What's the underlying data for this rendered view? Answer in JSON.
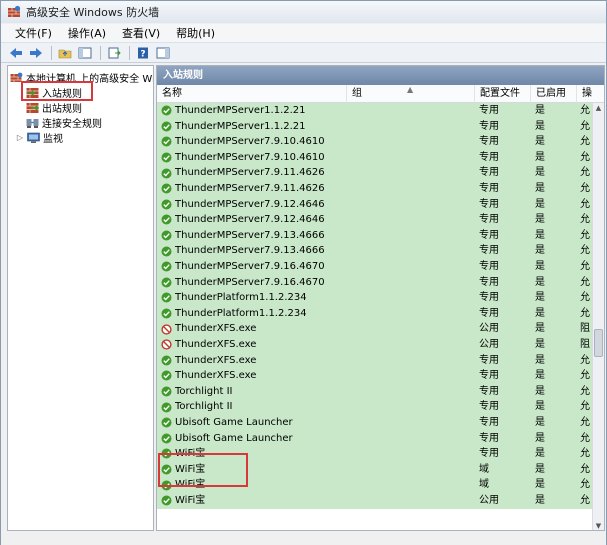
{
  "window": {
    "title": "高级安全 Windows 防火墙"
  },
  "menu": [
    "文件(F)",
    "操作(A)",
    "查看(V)",
    "帮助(H)"
  ],
  "tree": {
    "root": "本地计算机 上的高级安全 Windows",
    "items": [
      {
        "label": "入站规则",
        "icon": "inbound-rules-icon",
        "selected": true
      },
      {
        "label": "出站规则",
        "icon": "outbound-rules-icon"
      },
      {
        "label": "连接安全规则",
        "icon": "connection-security-icon"
      },
      {
        "label": "监视",
        "icon": "monitor-icon"
      }
    ]
  },
  "pane": {
    "header": "入站规则",
    "columns": [
      "名称",
      "组",
      "配置文件",
      "已启用",
      "操"
    ]
  },
  "rules": [
    {
      "name": "ThunderMPServer1.1.2.21",
      "group": "",
      "profile": "专用",
      "enabled": "是",
      "action": "允",
      "status": "allow"
    },
    {
      "name": "ThunderMPServer1.1.2.21",
      "group": "",
      "profile": "专用",
      "enabled": "是",
      "action": "允",
      "status": "allow"
    },
    {
      "name": "ThunderMPServer7.9.10.4610",
      "group": "",
      "profile": "专用",
      "enabled": "是",
      "action": "允",
      "status": "allow"
    },
    {
      "name": "ThunderMPServer7.9.10.4610",
      "group": "",
      "profile": "专用",
      "enabled": "是",
      "action": "允",
      "status": "allow"
    },
    {
      "name": "ThunderMPServer7.9.11.4626",
      "group": "",
      "profile": "专用",
      "enabled": "是",
      "action": "允",
      "status": "allow"
    },
    {
      "name": "ThunderMPServer7.9.11.4626",
      "group": "",
      "profile": "专用",
      "enabled": "是",
      "action": "允",
      "status": "allow"
    },
    {
      "name": "ThunderMPServer7.9.12.4646",
      "group": "",
      "profile": "专用",
      "enabled": "是",
      "action": "允",
      "status": "allow"
    },
    {
      "name": "ThunderMPServer7.9.12.4646",
      "group": "",
      "profile": "专用",
      "enabled": "是",
      "action": "允",
      "status": "allow"
    },
    {
      "name": "ThunderMPServer7.9.13.4666",
      "group": "",
      "profile": "专用",
      "enabled": "是",
      "action": "允",
      "status": "allow"
    },
    {
      "name": "ThunderMPServer7.9.13.4666",
      "group": "",
      "profile": "专用",
      "enabled": "是",
      "action": "允",
      "status": "allow"
    },
    {
      "name": "ThunderMPServer7.9.16.4670",
      "group": "",
      "profile": "专用",
      "enabled": "是",
      "action": "允",
      "status": "allow"
    },
    {
      "name": "ThunderMPServer7.9.16.4670",
      "group": "",
      "profile": "专用",
      "enabled": "是",
      "action": "允",
      "status": "allow"
    },
    {
      "name": "ThunderPlatform1.1.2.234",
      "group": "",
      "profile": "专用",
      "enabled": "是",
      "action": "允",
      "status": "allow"
    },
    {
      "name": "ThunderPlatform1.1.2.234",
      "group": "",
      "profile": "专用",
      "enabled": "是",
      "action": "允",
      "status": "allow"
    },
    {
      "name": "ThunderXFS.exe",
      "group": "",
      "profile": "公用",
      "enabled": "是",
      "action": "阻",
      "status": "block"
    },
    {
      "name": "ThunderXFS.exe",
      "group": "",
      "profile": "公用",
      "enabled": "是",
      "action": "阻",
      "status": "block"
    },
    {
      "name": "ThunderXFS.exe",
      "group": "",
      "profile": "专用",
      "enabled": "是",
      "action": "允",
      "status": "allow"
    },
    {
      "name": "ThunderXFS.exe",
      "group": "",
      "profile": "专用",
      "enabled": "是",
      "action": "允",
      "status": "allow"
    },
    {
      "name": "Torchlight II",
      "group": "",
      "profile": "专用",
      "enabled": "是",
      "action": "允",
      "status": "allow"
    },
    {
      "name": "Torchlight II",
      "group": "",
      "profile": "专用",
      "enabled": "是",
      "action": "允",
      "status": "allow"
    },
    {
      "name": "Ubisoft Game Launcher",
      "group": "",
      "profile": "专用",
      "enabled": "是",
      "action": "允",
      "status": "allow"
    },
    {
      "name": "Ubisoft Game Launcher",
      "group": "",
      "profile": "专用",
      "enabled": "是",
      "action": "允",
      "status": "allow"
    },
    {
      "name": "WiFi宝",
      "group": "",
      "profile": "专用",
      "enabled": "是",
      "action": "允",
      "status": "allow"
    },
    {
      "name": "WiFi宝",
      "group": "",
      "profile": "域",
      "enabled": "是",
      "action": "允",
      "status": "allow"
    },
    {
      "name": "WiFi宝",
      "group": "",
      "profile": "域",
      "enabled": "是",
      "action": "允",
      "status": "allow"
    },
    {
      "name": "WiFi宝",
      "group": "",
      "profile": "公用",
      "enabled": "是",
      "action": "允",
      "status": "allow"
    }
  ],
  "colors": {
    "row_bg": "#c9e8c9",
    "header_bg": "#7d94b4",
    "highlight": "#d9383a",
    "allow": "#3f9a2a",
    "block": "#c0392b"
  }
}
